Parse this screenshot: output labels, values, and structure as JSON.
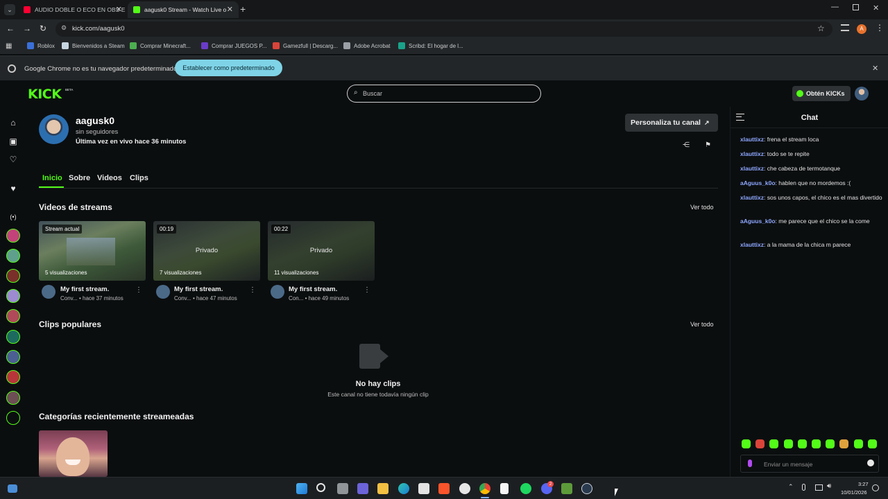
{
  "browser": {
    "tabs": [
      {
        "title": "AUDIO DOBLE O ECO EN OBS E",
        "favicon": "youtube-icon",
        "color": "#ff0033"
      },
      {
        "title": "aagusk0 Stream - Watch Live o",
        "favicon": "kick-icon",
        "color": "#53fc18"
      }
    ],
    "url": "kick.com/aagusk0",
    "profile_initial": "A",
    "bookmarks": [
      {
        "label": "Roblox",
        "color": "#3b6fd8"
      },
      {
        "label": "Bienvenidos a Steam",
        "color": "#c7d5e0"
      },
      {
        "label": "Comprar Minecraft...",
        "color": "#4caf50"
      },
      {
        "label": "Comprar JUEGOS P...",
        "color": "#6a3cc8"
      },
      {
        "label": "Gamezfull | Descarg...",
        "color": "#d9443a"
      },
      {
        "label": "Adobe Acrobat",
        "color": "#9aa0a6"
      },
      {
        "label": "Scribd: El hogar de l...",
        "color": "#1aa28a"
      }
    ],
    "infobar": {
      "message": "Google Chrome no es tu navegador predeterminado",
      "button": "Establecer como predeterminado"
    }
  },
  "kick": {
    "logo": "KICK",
    "logo_tag": "BETA",
    "search_placeholder": "Buscar",
    "get_kicks": "Obtén KICKs",
    "channel": {
      "name": "aagusk0",
      "followers": "sin seguidores",
      "last_live": "Última vez en vivo hace 36 minutos",
      "customize_button": "Personaliza tu canal"
    },
    "tabs": [
      "Inicio",
      "Sobre",
      "Videos",
      "Clips"
    ],
    "videos_section": {
      "title": "Videos de streams",
      "see_all": "Ver todo"
    },
    "videos": [
      {
        "badge": "Stream actual",
        "center": "",
        "views": "5 visualizaciones",
        "title": "My first stream.",
        "sub": "Conv... • hace 37 minutos"
      },
      {
        "badge": "00:19",
        "center": "Privado",
        "views": "7 visualizaciones",
        "title": "My first stream.",
        "sub": "Conv... • hace 47 minutos"
      },
      {
        "badge": "00:22",
        "center": "Privado",
        "views": "11 visualizaciones",
        "title": "My first stream.",
        "sub": "Con... • hace 49 minutos"
      }
    ],
    "clips_section": {
      "title": "Clips populares",
      "see_all": "Ver todo",
      "empty_title": "No hay clips",
      "empty_sub": "Este canal no tiene todavía ningún clip"
    },
    "categories_section": {
      "title": "Categorías recientemente streameadas"
    },
    "chat": {
      "title": "Chat",
      "input_placeholder": "Enviar un mensaje",
      "messages": [
        {
          "user": "xlauttixz",
          "text": "frena el stream loca"
        },
        {
          "user": "xlauttixz",
          "text": "todo se te repite"
        },
        {
          "user": "xlauttixz",
          "text": "che cabeza de termotanque"
        },
        {
          "user": "aAguus_k0o",
          "text": "hablen que no mordemos :("
        },
        {
          "user": "xlauttixz",
          "text": "sos unos capos, el chico es el mas divertido"
        },
        {
          "user": "aAguus_k0o",
          "text": "me parece que el chico se la come"
        },
        {
          "user": "xlauttixz",
          "text": "a la mama de la chica m parece"
        }
      ]
    }
  },
  "taskbar": {
    "time": "3:27",
    "date": "10/01/2026",
    "discord_badge": "2"
  },
  "colors": {
    "kick_green": "#53fc18",
    "chat_user": "#8ea7ff",
    "infobar_button": "#7fd3e6"
  }
}
